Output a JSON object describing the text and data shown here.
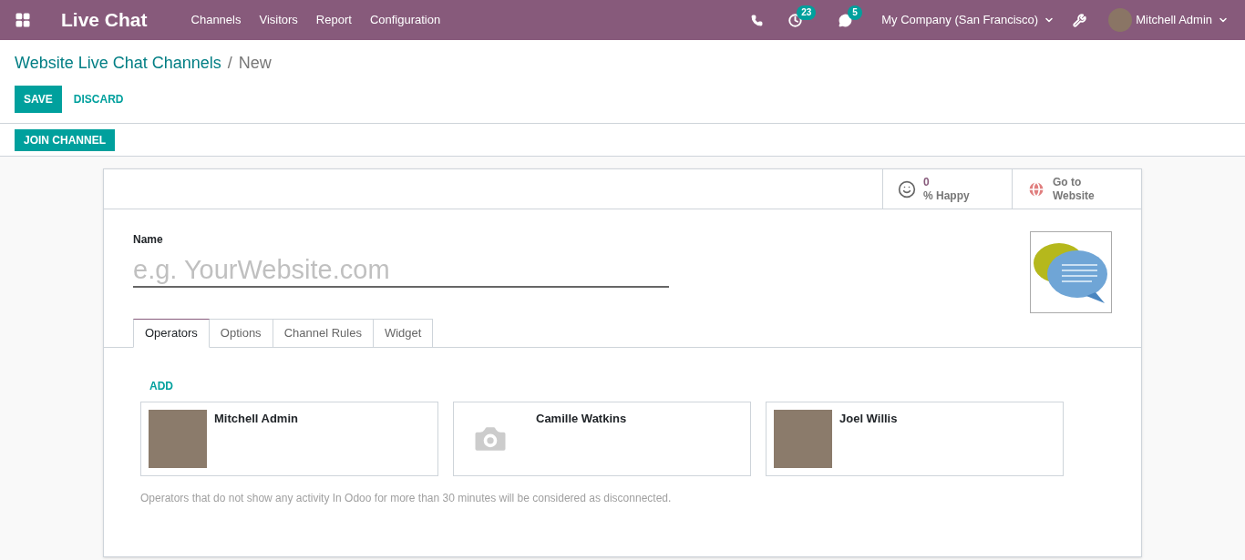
{
  "navbar": {
    "app_name": "Live Chat",
    "menu": [
      "Channels",
      "Visitors",
      "Report",
      "Configuration"
    ],
    "activity_count": "23",
    "message_count": "5",
    "company": "My Company (San Francisco)",
    "user": "Mitchell Admin"
  },
  "breadcrumb": {
    "parent": "Website Live Chat Channels",
    "separator": "/",
    "current": "New"
  },
  "actions": {
    "save": "SAVE",
    "discard": "DISCARD"
  },
  "status_buttons": [
    "JOIN CHANNEL"
  ],
  "smart_buttons": [
    {
      "kind": "happy",
      "value": "0",
      "label": "% Happy"
    },
    {
      "kind": "website",
      "value": "Go to",
      "label": "Website"
    }
  ],
  "form": {
    "name_label": "Name",
    "name_placeholder": "e.g. YourWebsite.com"
  },
  "tabs": [
    {
      "label": "Operators",
      "selected": true
    },
    {
      "label": "Options",
      "selected": false
    },
    {
      "label": "Channel Rules",
      "selected": false
    },
    {
      "label": "Widget",
      "selected": false
    }
  ],
  "add_link": "ADD",
  "operators": [
    {
      "name": "Mitchell Admin",
      "kind": "photo"
    },
    {
      "name": "Camille Watkins",
      "kind": "no-photo"
    },
    {
      "name": "Joel Willis",
      "kind": "photo"
    }
  ],
  "help_text": "Operators that do not show any activity In Odoo for more than 30 minutes will be considered as disconnected."
}
